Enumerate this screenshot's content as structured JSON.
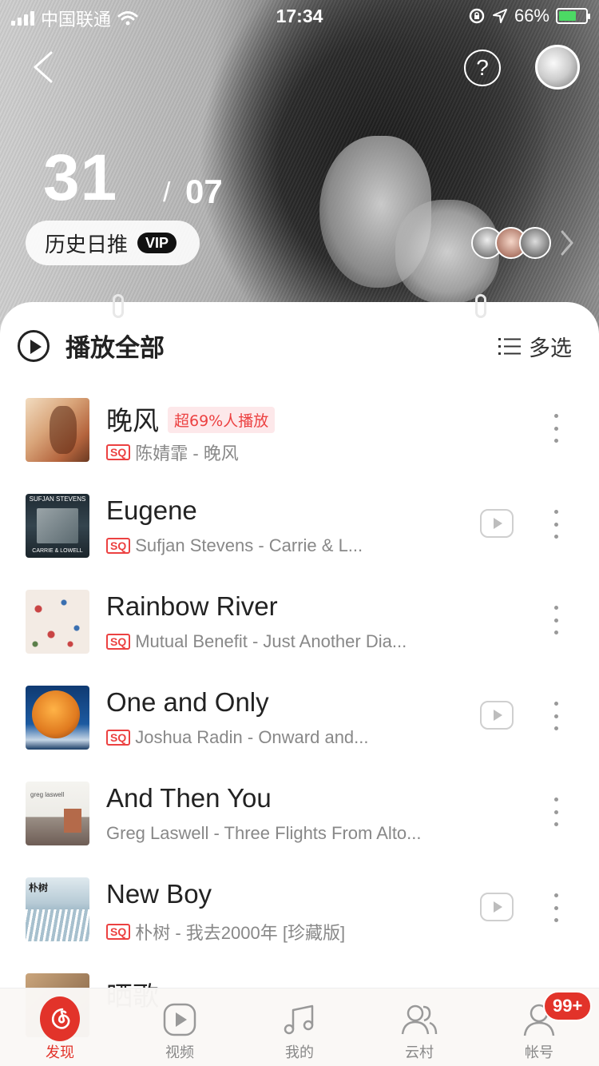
{
  "status_bar": {
    "carrier": "中国联通",
    "time": "17:34",
    "battery": "66%",
    "battery_level": 0.66
  },
  "header": {
    "help_label": "?"
  },
  "date": {
    "day": "31",
    "separator": "/",
    "month": "07"
  },
  "history": {
    "label": "历史日推",
    "vip_badge": "VIP"
  },
  "toolbar": {
    "play_all": "播放全部",
    "multi_select": "多选"
  },
  "songs": [
    {
      "title": "晚风",
      "hot_tag": "超69%人播放",
      "sq": "SQ",
      "subtitle": "陈婧霏 - 晚风",
      "has_mv": false
    },
    {
      "title": "Eugene",
      "sq": "SQ",
      "subtitle": "Sufjan Stevens - Carrie & L...",
      "has_mv": true,
      "cover_text_top": "SUFJAN STEVENS",
      "cover_text_bottom": "CARRIE & LOWELL"
    },
    {
      "title": "Rainbow River",
      "sq": "SQ",
      "subtitle": "Mutual Benefit - Just Another Dia...",
      "has_mv": false
    },
    {
      "title": "One and Only",
      "sq": "SQ",
      "subtitle": "Joshua Radin - Onward and...",
      "has_mv": true
    },
    {
      "title": "And Then You",
      "sq": "",
      "subtitle": "Greg Laswell - Three Flights From Alto...",
      "has_mv": false,
      "cover_text_top": "greg laswell"
    },
    {
      "title": "New Boy",
      "sq": "SQ",
      "subtitle": "朴树 - 我去2000年 [珍藏版]",
      "has_mv": true,
      "cover_text_top": "朴树"
    },
    {
      "title": "晒歌",
      "sq": "",
      "subtitle": "",
      "has_mv": false
    }
  ],
  "tabbar": {
    "tabs": [
      {
        "label": "发现",
        "icon": "netease-music-icon",
        "active": true
      },
      {
        "label": "视频",
        "icon": "video-icon",
        "active": false
      },
      {
        "label": "我的",
        "icon": "music-note-icon",
        "active": false
      },
      {
        "label": "云村",
        "icon": "friends-icon",
        "active": false
      },
      {
        "label": "帐号",
        "icon": "account-icon",
        "active": false
      }
    ],
    "account_badge": "99+"
  },
  "colors": {
    "accent": "#e2332a",
    "sq_red": "#ec4141"
  }
}
